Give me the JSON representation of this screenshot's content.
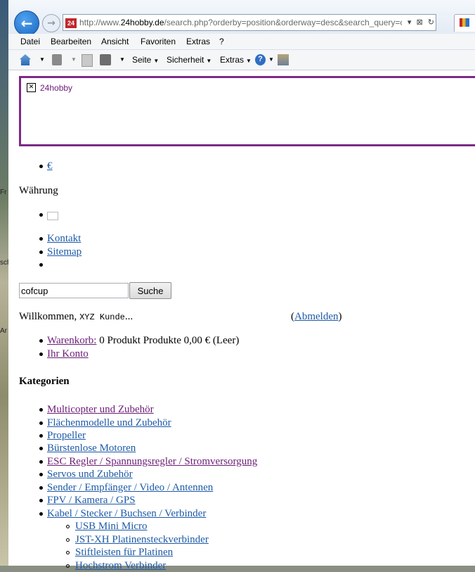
{
  "desktop": {
    "labels": [
      "Fr",
      "sch",
      "Ar"
    ]
  },
  "browser": {
    "url_prefix": "http://www.",
    "url_domain": "24hobby.de",
    "url_path": "/search.php?orderby=position&orderway=desc&search_query=co",
    "favicon_text": "24",
    "back_glyph": "←",
    "forward_glyph": "→",
    "url_tools": [
      "▾",
      "⊠",
      "↻"
    ],
    "menu": [
      "Datei",
      "Bearbeiten",
      "Ansicht",
      "Favoriten",
      "Extras",
      "?"
    ],
    "commands": {
      "seite": "Seite",
      "sicherheit": "Sicherheit",
      "extras": "Extras",
      "help_glyph": "?",
      "caret": "▼"
    }
  },
  "page": {
    "banner_alt": "24hobby",
    "broken_image_glyph": "✕",
    "currency_link": "€",
    "currency_label": "Währung",
    "top_links": [
      "Kontakt",
      "Sitemap"
    ],
    "search": {
      "value": "cofcup",
      "button": "Suche"
    },
    "welcome": {
      "prefix": "Willkommen,",
      "name": "XYZ Kunde",
      "suffix": "...",
      "open_paren": "(",
      "logout": "Abmelden",
      "close_paren": ")"
    },
    "cart": {
      "link": "Warenkorb:",
      "summary": "0 Produkt Produkte 0,00 € (Leer)"
    },
    "account_link": "Ihr Konto",
    "categories_heading": "Kategorien",
    "categories": [
      "Multicopter und Zubehör",
      "Flächenmodelle und Zubehör",
      "Propeller",
      "Bürstenlose Motoren",
      "ESC Regler / Spannungsregler / Stromversorgung",
      "Servos und Zubehör",
      "Sender / Empfänger / Video / Antennen",
      "FPV / Kamera / GPS",
      "Kabel / Stecker / Buchsen / Verbinder"
    ],
    "subcategories": [
      "USB Mini Micro",
      "JST-XH Platinensteckverbinder",
      "Stiftleisten für Platinen",
      "Hochstrom Verbinder"
    ]
  }
}
